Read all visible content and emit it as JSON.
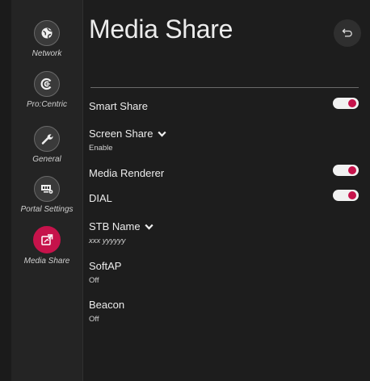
{
  "sidebar": {
    "items": [
      {
        "label": "Network",
        "icon": "globe-icon"
      },
      {
        "label": "Pro:Centric",
        "icon": "procentric-icon"
      },
      {
        "label": "General",
        "icon": "wrench-icon"
      },
      {
        "label": "Portal Settings",
        "icon": "portal-icon"
      },
      {
        "label": "Media Share",
        "icon": "media-share-icon",
        "active": true
      }
    ]
  },
  "header": {
    "title": "Media Share",
    "back_icon": "back-arrow-icon"
  },
  "settings": [
    {
      "label": "Smart Share",
      "toggle": true
    },
    {
      "label": "Screen Share",
      "value": "Enable",
      "dropdown": true
    },
    {
      "label": "Media Renderer",
      "toggle": true
    },
    {
      "label": "DIAL",
      "toggle": true
    },
    {
      "label": "STB Name",
      "value": "xxx yyyyyy",
      "dropdown": true
    },
    {
      "label": "SoftAP",
      "value": "Off"
    },
    {
      "label": "Beacon",
      "value": "Off"
    }
  ],
  "colors": {
    "accent": "#c6134b",
    "toggle_track": "#f1f1f1",
    "background": "#1d1d1d",
    "sidebar": "#242424"
  }
}
